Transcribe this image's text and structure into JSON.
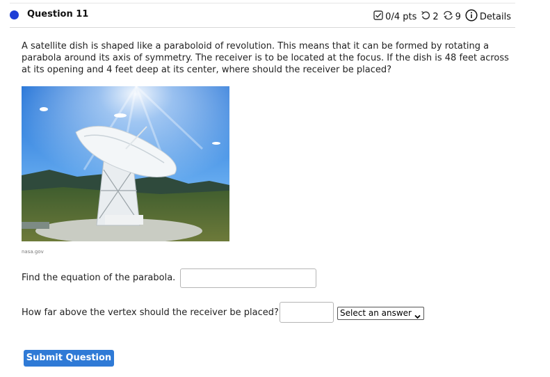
{
  "question": {
    "title": "Question 11",
    "points": "0/4 pts",
    "attempts": "2",
    "retries": "9",
    "details_label": "Details"
  },
  "prompt": "A satellite dish is shaped like a paraboloid of revolution. This means that it can be formed by rotating a parabola around its axis of symmetry. The receiver is to be located at the focus. If the dish is 48 feet across at its opening and 4 feet deep at its center, where should the receiver be placed?",
  "image": {
    "credit": "nasa.gov"
  },
  "parts": {
    "equation_label": "Find the equation of the parabola.",
    "equation_value": "",
    "distance_label": "How far above the vertex should the receiver be placed?",
    "distance_value": "",
    "unit_select": "Select an answer"
  },
  "submit_label": "Submit Question",
  "colors": {
    "accent": "#2f7ad6",
    "dot": "#1f3fd6"
  }
}
